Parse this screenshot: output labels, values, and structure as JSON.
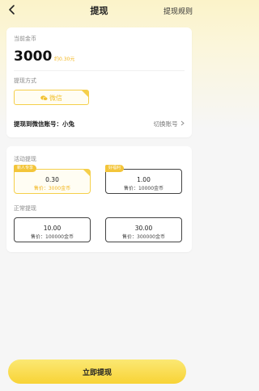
{
  "nav": {
    "title": "提现",
    "right_link": "提现规则"
  },
  "balance": {
    "label": "当前金币",
    "value": "3000",
    "approx": "约0.30元"
  },
  "method": {
    "label": "提现方式",
    "option": "微信",
    "account_line": "提现到微信账号：小兔",
    "switch_label": "切换账号"
  },
  "activity": {
    "label": "活动提现",
    "options": [
      {
        "tag": "新人专享",
        "amount": "0.30",
        "price": "售价：3000金币",
        "selected": true
      },
      {
        "tag": "好福利",
        "amount": "1.00",
        "price": "售价：10000金币",
        "selected": false
      }
    ]
  },
  "normal": {
    "label": "正常提现",
    "options": [
      {
        "amount": "10.00",
        "price": "售价：100000金币"
      },
      {
        "amount": "30.00",
        "price": "售价：300000金币"
      }
    ]
  },
  "submit_label": "立即提现",
  "colors": {
    "accent": "#f5cf4a",
    "price_accent": "#f1b51c",
    "button": "#f8d336"
  },
  "icons": [
    "back-arrow-icon",
    "chevron-right-icon",
    "wechat-icon"
  ]
}
